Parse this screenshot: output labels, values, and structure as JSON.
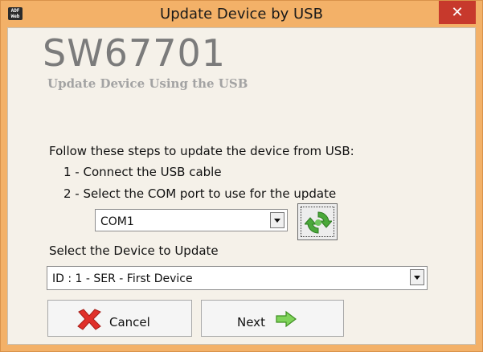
{
  "window": {
    "title": "Update Device by USB",
    "icon_text_top": "ADF",
    "icon_text_bottom": "Web",
    "close_glyph": "✕"
  },
  "product": {
    "name": "SW67701",
    "subtitle": "Update Device Using the USB"
  },
  "steps": {
    "intro": "Follow these steps to update the device from USB:",
    "step1": "1 - Connect the USB cable",
    "step2": "2 - Select the COM port to use for the update"
  },
  "com_port": {
    "selected": "COM1"
  },
  "device": {
    "label": "Select the Device to Update",
    "selected": "ID : 1 - SER - First Device"
  },
  "buttons": {
    "cancel": "Cancel",
    "next": "Next"
  },
  "icons": {
    "app": "adfweb-logo-icon",
    "refresh": "refresh-icon",
    "cancel": "red-x-icon",
    "next": "green-arrow-icon"
  },
  "colors": {
    "titlebar": "#f3b168",
    "close": "#c7392c",
    "client_bg": "#f5f1e9",
    "product_text": "#7b7b7b",
    "subtitle_text": "#a3a3a3"
  }
}
